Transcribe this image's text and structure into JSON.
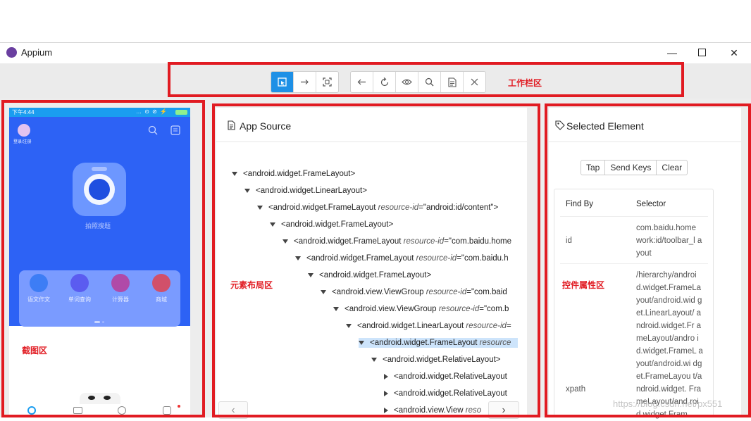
{
  "window": {
    "title": "Appium",
    "min_symbol": "—",
    "max_symbol": "☐",
    "close_symbol": "✕"
  },
  "toolbar": {
    "group1": [
      "select-icon",
      "swipe-icon",
      "tap-by-coordinate-icon"
    ],
    "group2": [
      "back-icon",
      "refresh-icon",
      "eye-icon",
      "search-icon",
      "clipboard-icon",
      "close-icon"
    ],
    "annotation": "工作栏区"
  },
  "screenshot": {
    "status_time": "下午4:44",
    "status_right": "… ⊙ ⊘ ⚡",
    "login_text": "登录/注册",
    "center_label": "拍照搜题",
    "features": [
      {
        "label": "语文作文",
        "color": "#3d7df5"
      },
      {
        "label": "单词查询",
        "color": "#5b5cf0"
      },
      {
        "label": "计算器",
        "color": "#b04aa8"
      },
      {
        "label": "商城",
        "color": "#d1506a"
      }
    ],
    "annotation": "截图区"
  },
  "source": {
    "header": "App Source",
    "annotation": "元素布局区",
    "lines": [
      {
        "indent": 0,
        "tri": "down",
        "tag": "<android.widget.FrameLayout>",
        "attr": "",
        "value": "",
        "tail": ""
      },
      {
        "indent": 1,
        "tri": "down",
        "tag": "<android.widget.LinearLayout>",
        "attr": "",
        "value": "",
        "tail": ""
      },
      {
        "indent": 2,
        "tri": "down",
        "tag": "<android.widget.FrameLayout ",
        "attr": "resource-id",
        "value": "=\"android:id/content\"",
        "tail": ">"
      },
      {
        "indent": 3,
        "tri": "down",
        "tag": "<android.widget.FrameLayout>",
        "attr": "",
        "value": "",
        "tail": ""
      },
      {
        "indent": 4,
        "tri": "down",
        "tag": "<android.widget.FrameLayout ",
        "attr": "resource-id",
        "value": "=\"com.baidu.home",
        "tail": ""
      },
      {
        "indent": 5,
        "tri": "down",
        "tag": "<android.widget.FrameLayout ",
        "attr": "resource-id",
        "value": "=\"com.baidu.h",
        "tail": ""
      },
      {
        "indent": 6,
        "tri": "down",
        "tag": "<android.widget.FrameLayout>",
        "attr": "",
        "value": "",
        "tail": ""
      },
      {
        "indent": 7,
        "tri": "down",
        "tag": "<android.view.ViewGroup ",
        "attr": "resource-id",
        "value": "=\"com.baid",
        "tail": ""
      },
      {
        "indent": 8,
        "tri": "down",
        "tag": "<android.view.ViewGroup ",
        "attr": "resource-id",
        "value": "=\"com.b",
        "tail": ""
      },
      {
        "indent": 9,
        "tri": "down",
        "tag": "<android.widget.LinearLayout ",
        "attr": "resource-id",
        "value": "=",
        "tail": ""
      },
      {
        "indent": 10,
        "tri": "down",
        "tag": "<android.widget.FrameLayout ",
        "attr": "resource",
        "value": "",
        "tail": "",
        "selected": true
      },
      {
        "indent": 11,
        "tri": "down",
        "tag": "<android.widget.RelativeLayout>",
        "attr": "",
        "value": "",
        "tail": ""
      },
      {
        "indent": 12,
        "tri": "right",
        "tag": "<android.widget.RelativeLayout",
        "attr": "",
        "value": "",
        "tail": ""
      },
      {
        "indent": 12,
        "tri": "right",
        "tag": "<android.widget.RelativeLayout",
        "attr": "",
        "value": "",
        "tail": ""
      },
      {
        "indent": 12,
        "tri": "right",
        "tag": "<android.view.View ",
        "attr": "reso",
        "value": "",
        "tail": ""
      }
    ],
    "scroll_left": "‹",
    "scroll_right": "›"
  },
  "selected": {
    "header": "Selected Element",
    "annotation": "控件属性区",
    "buttons": [
      "Tap",
      "Send Keys",
      "Clear"
    ],
    "col_find_by": "Find By",
    "col_selector": "Selector",
    "rows": [
      {
        "find_by": "id",
        "selector": "com.baidu.home work:id/toolbar_l ayout"
      },
      {
        "find_by": "xpath",
        "selector": "/hierarchy/androi d.widget.FrameLa yout/android.wid get.LinearLayout/ android.widget.Fr ameLayout/andro id.widget.FrameL ayout/android.wi dget.FrameLayou t/android.widget. FrameLayout/and roid.widget.Fram"
      }
    ]
  },
  "watermark": "https://blog.csdn.net/px551"
}
